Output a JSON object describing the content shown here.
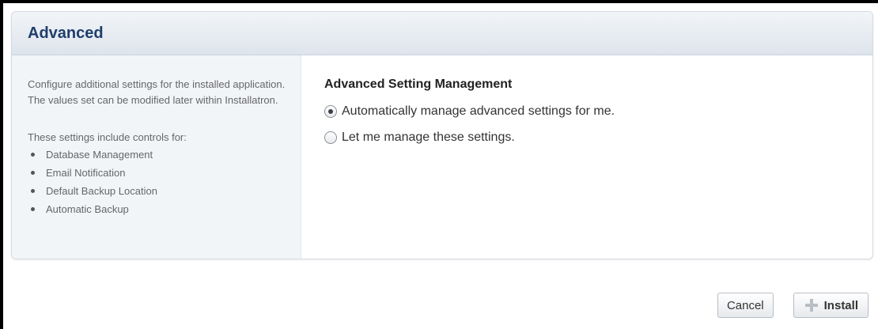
{
  "panel": {
    "title": "Advanced"
  },
  "sidebar": {
    "description": "Configure additional settings for the installed application. The values set can be modified later within Installatron.",
    "list_intro": "These settings include controls for:",
    "items": [
      "Database Management",
      "Email Notification",
      "Default Backup Location",
      "Automatic Backup"
    ]
  },
  "main": {
    "heading": "Advanced Setting Management",
    "options": [
      {
        "label": "Automatically manage advanced settings for me.",
        "checked": true
      },
      {
        "label": "Let me manage these settings.",
        "checked": false
      }
    ]
  },
  "footer": {
    "cancel_label": "Cancel",
    "install_label": "Install",
    "install_icon": "plus-icon"
  }
}
